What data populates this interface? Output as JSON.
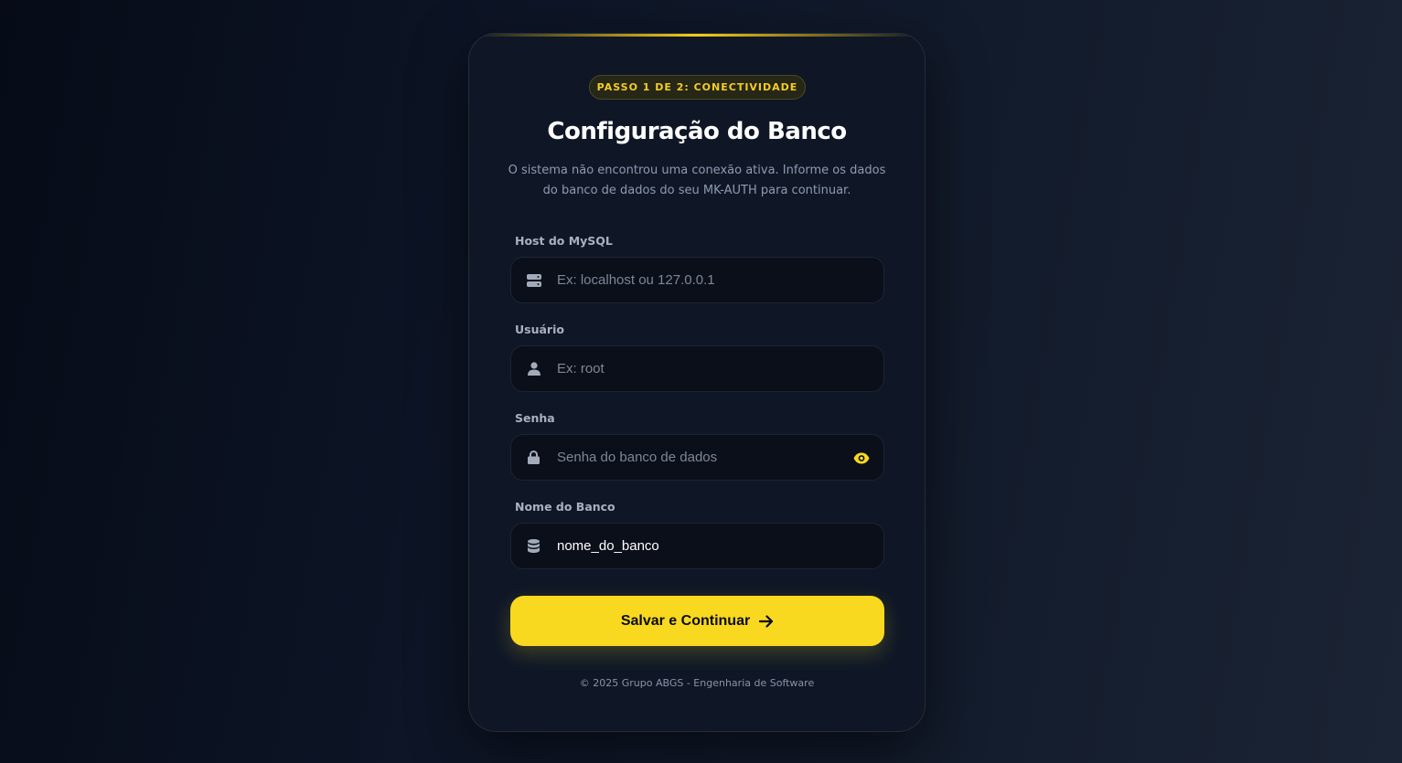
{
  "badge": "PASSO 1 DE 2: CONECTIVIDADE",
  "title": "Configuração do Banco",
  "subtitle": "O sistema não encontrou uma conexão ativa. Informe os dados do banco de dados do seu MK-AUTH para continuar.",
  "fields": {
    "host": {
      "label": "Host do MySQL",
      "placeholder": "Ex: localhost ou 127.0.0.1",
      "value": "",
      "icon": "server-icon"
    },
    "user": {
      "label": "Usuário",
      "placeholder": "Ex: root",
      "value": "",
      "icon": "user-icon"
    },
    "password": {
      "label": "Senha",
      "placeholder": "Senha do banco de dados",
      "value": "",
      "icon": "lock-icon",
      "toggle_icon": "eye-icon"
    },
    "dbname": {
      "label": "Nome do Banco",
      "placeholder": "",
      "value": "nome_do_banco",
      "icon": "database-icon"
    }
  },
  "submit": {
    "label": "Salvar e Continuar",
    "icon": "arrow-right-icon"
  },
  "footer": "© 2025 Grupo ABGS - Engenharia de Software",
  "colors": {
    "accent": "#f8d91f",
    "background": "#0d1526",
    "card": "#0f1727",
    "input_bg": "#0a0f19",
    "muted_text": "#8e9ab0"
  }
}
